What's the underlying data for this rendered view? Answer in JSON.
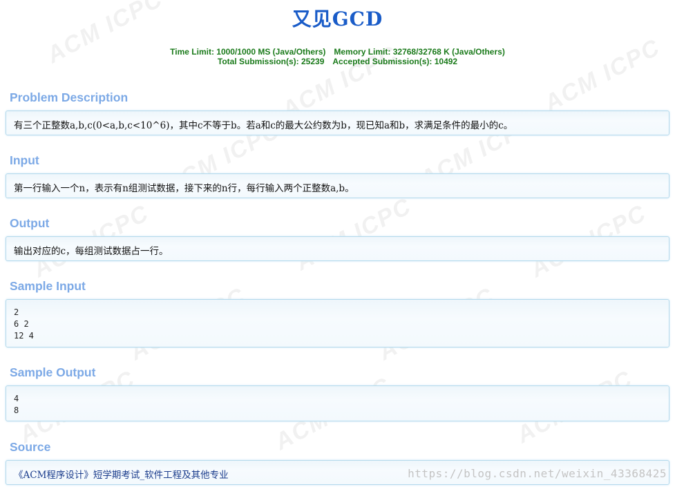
{
  "problem": {
    "title": "又见GCD",
    "limits_line1": {
      "time": "Time Limit: 1000/1000 MS (Java/Others)",
      "memory": "Memory Limit: 32768/32768 K (Java/Others)"
    },
    "limits_line2": {
      "total": "Total Submission(s): 25239",
      "accepted": "Accepted Submission(s): 10492"
    }
  },
  "sections": {
    "description": {
      "heading": "Problem Description",
      "text": "有三个正整数a,b,c(0<a,b,c<10^6)，其中c不等于b。若a和c的最大公约数为b，现已知a和b，求满足条件的最小的c。"
    },
    "input": {
      "heading": "Input",
      "text": "第一行输入一个n，表示有n组测试数据，接下来的n行，每行输入两个正整数a,b。"
    },
    "output": {
      "heading": "Output",
      "text": "输出对应的c，每组测试数据占一行。"
    },
    "sample_input": {
      "heading": "Sample Input",
      "text": "2\n6 2\n12 4"
    },
    "sample_output": {
      "heading": "Sample Output",
      "text": "4\n8"
    },
    "source": {
      "heading": "Source",
      "text": "《ACM程序设计》短学期考试_软件工程及其他专业"
    }
  },
  "watermarks": {
    "background_text": "ACM ICPC",
    "csdn_url": "https://blog.csdn.net/weixin_43368425"
  },
  "colors": {
    "title": "#1a5cc8",
    "limits": "#1a7a1a",
    "section_heading": "#7ca9e6",
    "panel_border": "#b3d9ec"
  }
}
